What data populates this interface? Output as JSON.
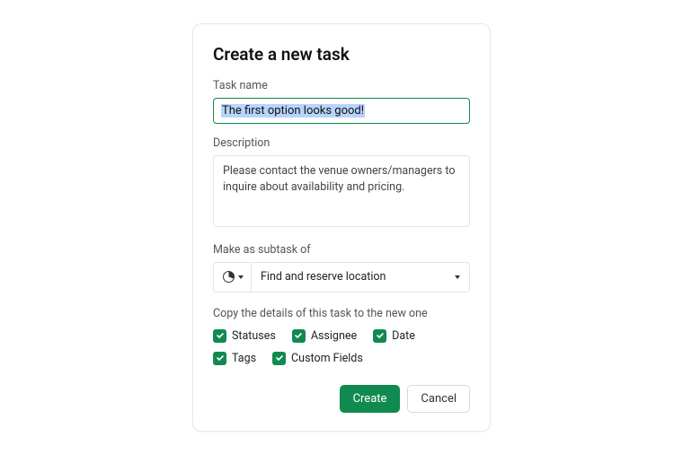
{
  "dialog": {
    "title": "Create a new task",
    "task_name_label": "Task name",
    "task_name_value": "The first option looks good!",
    "description_label": "Description",
    "description_value": "Please contact the venue owners/managers to inquire about availability and pricing.",
    "subtask_label": "Make as subtask of",
    "subtask_value": "Find and reserve location",
    "copy_label": "Copy the details of this task to the new one",
    "checkboxes": {
      "statuses": "Statuses",
      "assignee": "Assignee",
      "date": "Date",
      "tags": "Tags",
      "custom_fields": "Custom Fields"
    },
    "create_label": "Create",
    "cancel_label": "Cancel"
  }
}
